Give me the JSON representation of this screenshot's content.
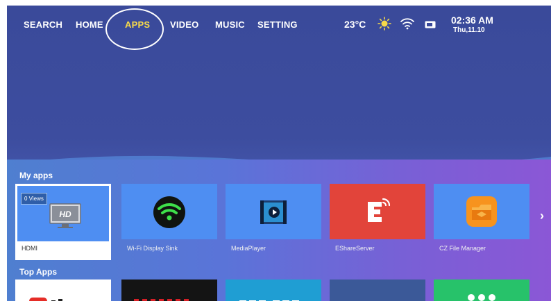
{
  "nav": {
    "search": "SEARCH",
    "home": "HOME",
    "apps": "APPS",
    "video": "VIDEO",
    "music": "MUSIC",
    "setting": "SETTING"
  },
  "status": {
    "temperature": "23°C",
    "time": "02:36 AM",
    "date": "Thu,11.10",
    "weather_icon": "sun-icon",
    "wifi_icon": "wifi-icon",
    "storage_icon": "sd-card-icon"
  },
  "my_apps": {
    "title": "My apps",
    "views_badge": "0 Views",
    "items": [
      {
        "label": "HDMI",
        "icon": "hdmi-tv-icon",
        "color": "#4e8ef2"
      },
      {
        "label": "Wi-Fi Display Sink",
        "icon": "wifi-display-icon",
        "color": "#4e8ef2"
      },
      {
        "label": "MediaPlayer",
        "icon": "media-player-icon",
        "color": "#4e8ef2"
      },
      {
        "label": "EShareServer",
        "icon": "eshare-icon",
        "color": "#e2443a"
      },
      {
        "label": "CZ File Manager",
        "icon": "file-manager-icon",
        "color": "#4e8ef2"
      }
    ]
  },
  "top_apps": {
    "title": "Top Apps",
    "items": [
      {
        "icon": "youtube-icon",
        "color": "#ffffff"
      },
      {
        "icon": "netflix-icon",
        "color": "#141414"
      },
      {
        "icon": "prime-video-icon",
        "color": "#1f9ed3"
      },
      {
        "icon": "facebook-icon",
        "color": "#3b5998"
      },
      {
        "icon": "more-apps-icon",
        "color": "#27c26a"
      }
    ]
  },
  "colors": {
    "accent": "#f6d94a",
    "background": "#3a4a9a"
  }
}
